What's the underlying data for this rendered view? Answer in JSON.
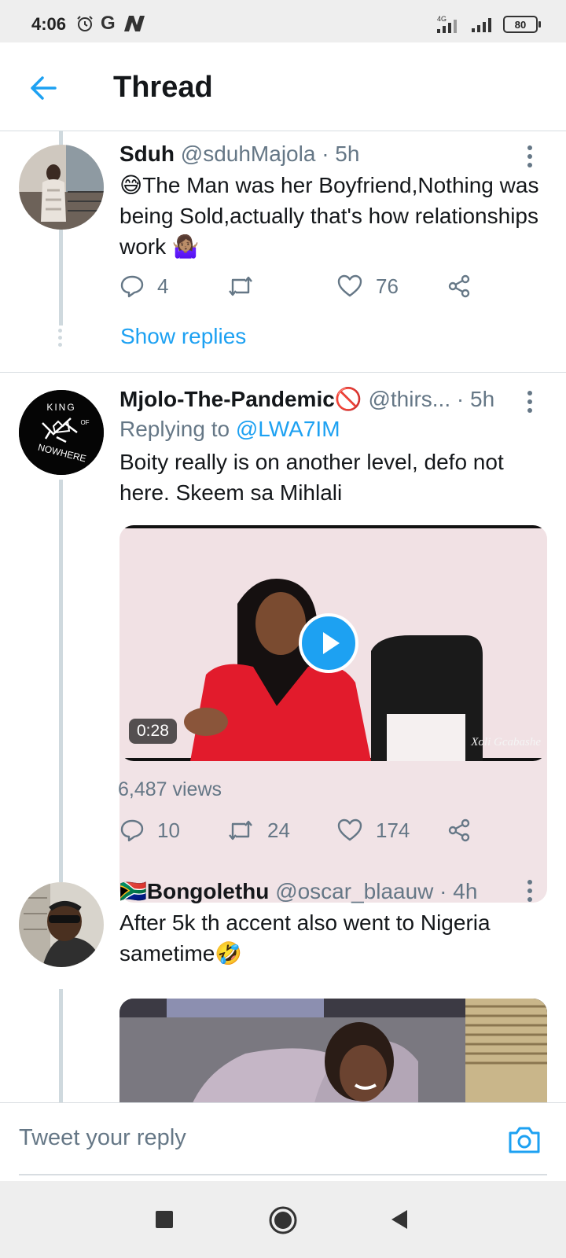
{
  "status_bar": {
    "time": "4:06",
    "left_letters": "G",
    "network": "4G",
    "battery": "80"
  },
  "header": {
    "title": "Thread"
  },
  "tweets": [
    {
      "name": "Sduh",
      "handle": "@sduhMajola",
      "time": "· 5h",
      "text_emoji_start": "😅",
      "text": "The Man was her Boyfriend,Nothing was being Sold,actually that's how relationships work",
      "text_emoji_end": "🤷🏽‍♀️",
      "replies": "4",
      "retweets": "",
      "likes": "76",
      "show_replies": "Show replies"
    },
    {
      "name": "Mjolo-The-Pandemic",
      "name_emoji": "🚫",
      "handle": "@thirs...",
      "time": "· 5h",
      "replying_prefix": "Replying to",
      "replying_to": "@LWA7IM",
      "text": "Boity really is on another level, defo not here. Skeem sa Mihlali",
      "video_duration": "0:28",
      "video_watermark": "Xoli Gcabashe",
      "views": "6,487 views",
      "replies": "10",
      "retweets": "24",
      "likes": "174",
      "avatar_text_top": "KING",
      "avatar_text_side": "OF",
      "avatar_text_bottom": "NOWHERE"
    },
    {
      "name_flag": "🇿🇦",
      "name": "Bongolethu",
      "handle": "@oscar_blaauw",
      "time": "· 4h",
      "text": "After 5k th accent also went to Nigeria sametime",
      "text_emoji_end": "🤣"
    }
  ],
  "reply_bar": {
    "placeholder": "Tweet your reply"
  },
  "colors": {
    "accent": "#1da1f2",
    "secondary_text": "#657786",
    "line": "#cfd9de"
  }
}
